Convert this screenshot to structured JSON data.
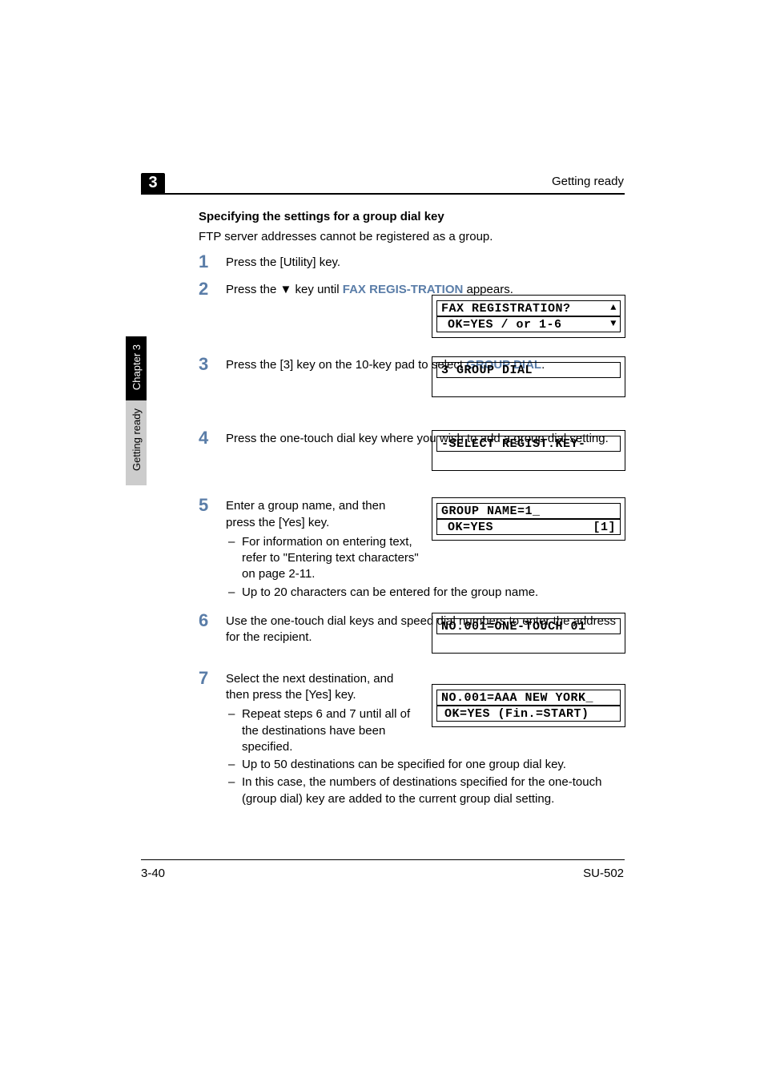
{
  "header": {
    "chapter_badge": "3",
    "right_label": "Getting ready"
  },
  "side_tab": {
    "black_text": "Chapter 3",
    "gray_text": "Getting ready"
  },
  "section_title": "Specifying the settings for a group dial key",
  "intro": "FTP server addresses cannot be registered as a group.",
  "steps": {
    "s1": {
      "num": "1",
      "text": "Press the [Utility] key."
    },
    "s2": {
      "num": "2",
      "pre": "Press the ",
      "arrow": "▼",
      "mid": " key until ",
      "cap": "FAX REGIS-TRATION",
      "post": " appears."
    },
    "s3": {
      "num": "3",
      "pre": "Press the [3] key on the 10-key pad to select ",
      "cap": "GROUP DIAL",
      "post": "."
    },
    "s4": {
      "num": "4",
      "text": "Press the one-touch dial key where you wish to add a group dial setting."
    },
    "s5": {
      "num": "5",
      "text": "Enter a group name, and then press the [Yes] key.",
      "bullets": [
        "For information on entering text, refer to \"Entering text characters\" on page 2-11.",
        "Up to 20 characters can be entered for the group name."
      ]
    },
    "s6": {
      "num": "6",
      "text": "Use the one-touch dial keys and speed dial numbers to enter the address for the recipient."
    },
    "s7": {
      "num": "7",
      "text": "Select the next destination, and then press the [Yes] key.",
      "bullets": [
        "Repeat steps 6 and 7 until all of the destinations have been specified.",
        "Up to 50 destinations can be specified for one group dial key.",
        "In this case, the numbers of destinations specified for the one-touch (group dial) key are added to the current group dial setting."
      ]
    }
  },
  "lcd": {
    "l2a": "FAX REGISTRATION?",
    "l2b": "OK=YES / or 1-6",
    "l3": "3 GROUP DIAL",
    "l4": "-SELECT REGIST.KEY-",
    "l5a": "GROUP NAME=1_",
    "l5b_left": "OK=YES",
    "l5b_right": "[1]",
    "l6": "NO.001=ONE-TOUCH 01",
    "l7a": "NO.001=AAA NEW YORK_",
    "l7b": "OK=YES  (Fin.=START)"
  },
  "footer": {
    "left": "3-40",
    "right": "SU-502"
  }
}
